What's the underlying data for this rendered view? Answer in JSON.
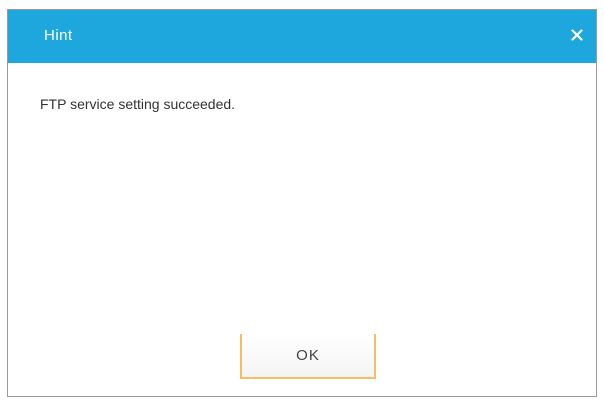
{
  "dialog": {
    "title": "Hint",
    "message": "FTP service setting succeeded.",
    "close_icon": "close-icon",
    "ok_label": "OK",
    "colors": {
      "titlebar": "#1ea7dc",
      "button_border": "#f7bd63"
    }
  }
}
